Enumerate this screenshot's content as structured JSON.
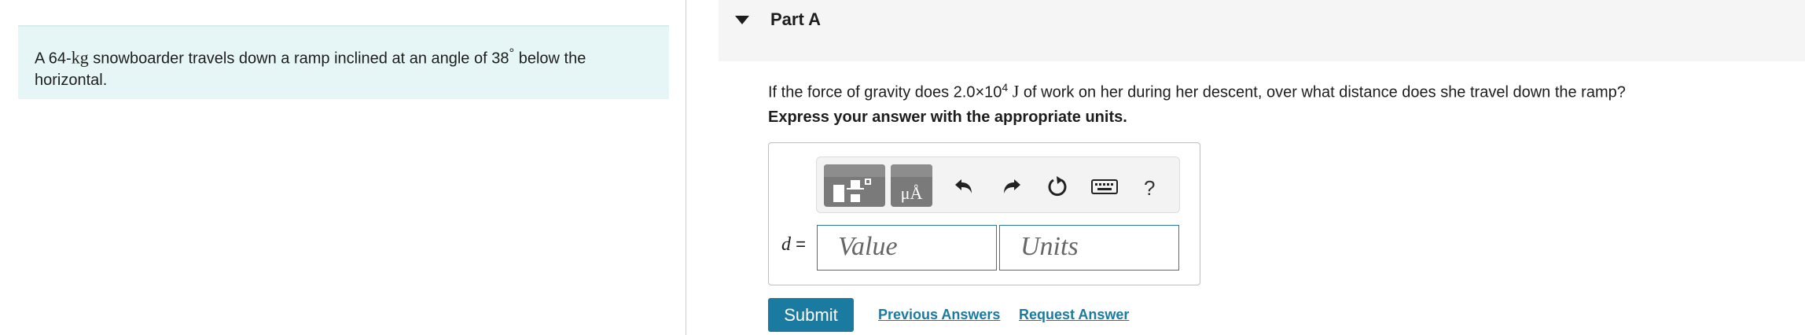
{
  "problem": {
    "text_before": "A 64-",
    "mass_unit": "kg",
    "text_middle": " snowboarder travels down a ramp inclined at an angle of 38",
    "degree": "°",
    "text_after": " below the horizontal."
  },
  "part": {
    "title": "Part A",
    "caret_icon": "caret-down-icon"
  },
  "question": {
    "before": "If the force of gravity does 2.0×10",
    "exponent": "4",
    "unit": "J",
    "after": " of work on her during her descent, over what distance does she travel down the ramp?"
  },
  "instruction": "Express your answer with the appropriate units.",
  "answer": {
    "variable": "d",
    "equals": " =",
    "value_placeholder": "Value",
    "units_placeholder": "Units"
  },
  "toolbar": {
    "templates_icon": "templates-icon",
    "units_icon": "units-icon",
    "units_glyph": "μÅ",
    "undo_icon": "undo-icon",
    "redo_icon": "redo-icon",
    "reset_icon": "reset-icon",
    "keyboard_icon": "keyboard-icon",
    "help_label": "?"
  },
  "buttons": {
    "submit": "Submit",
    "previous_answers": "Previous Answers",
    "request_answer": "Request Answer"
  },
  "colors": {
    "problem_bg": "#e6f6f6",
    "accent": "#1b7aa0",
    "input_border": "#2a7aa8"
  }
}
